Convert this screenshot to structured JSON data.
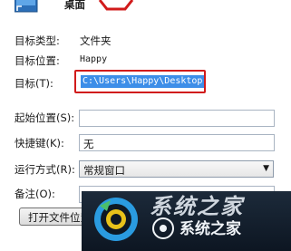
{
  "header": {
    "title": "桌面"
  },
  "fields": {
    "target_type_label": "目标类型:",
    "target_type_value": "文件夹",
    "target_location_label": "目标位置:",
    "target_location_value": "Happy",
    "target_label": "目标(T):",
    "target_value": "C:\\Users\\Happy\\Desktop",
    "start_in_label": "起始位置(S):",
    "start_in_value": "",
    "shortcut_key_label": "快捷键(K):",
    "shortcut_key_value": "无",
    "run_label": "运行方式(R):",
    "run_value": "常规窗口",
    "comment_label": "备注(O):",
    "comment_value": ""
  },
  "buttons": {
    "open_location": "打开文件位置(F)"
  },
  "watermark": {
    "top_text": "系统之家",
    "main_text": "系统之家"
  },
  "colors": {
    "highlight": "#d11b1b",
    "selection": "#3d8ee8",
    "watermark_bg": "#14202e"
  }
}
